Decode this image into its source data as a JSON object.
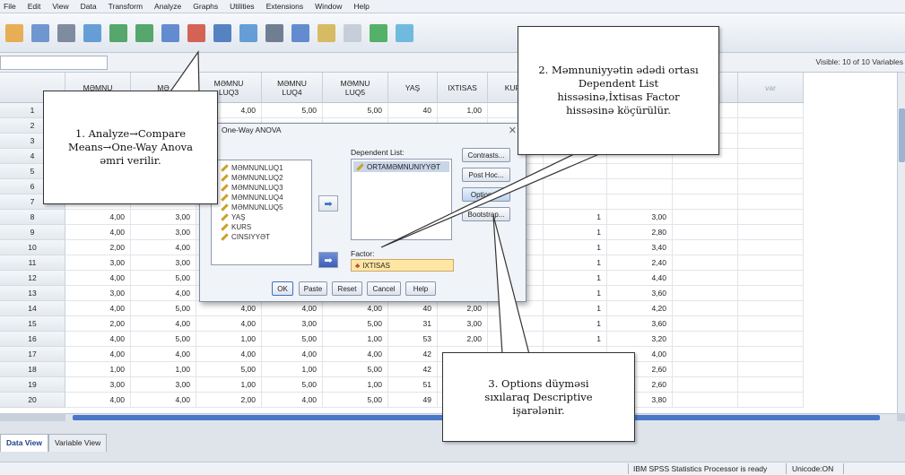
{
  "menu": [
    "File",
    "Edit",
    "View",
    "Data",
    "Transform",
    "Analyze",
    "Graphs",
    "Utilities",
    "Extensions",
    "Window",
    "Help"
  ],
  "toolbar_icons": [
    "open-icon",
    "save-icon",
    "print-icon",
    "dialog-recall-icon",
    "undo-icon",
    "redo-icon",
    "goto-case-icon",
    "goto-variable-icon",
    "variables-icon",
    "run-descriptives-icon",
    "find-icon",
    "insert-cases-icon",
    "insert-variable-icon",
    "split-file-icon",
    "weight-cases-icon",
    "select-cases-icon"
  ],
  "visible_vars": "Visible: 10 of 10 Variables",
  "columns": [
    "MƏMNU",
    "MƏ",
    "MƏMNU\nLUQ3",
    "MƏMNU\nLUQ4",
    "MƏMNU\nLUQ5",
    "YAŞ",
    "IXTISAS",
    "KURS",
    "",
    "var",
    "var",
    "var"
  ],
  "rows": [
    {
      "n": "1",
      "cells": [
        "",
        "",
        "4,00",
        "5,00",
        "5,00",
        "40",
        "1,00",
        "",
        "",
        "",
        "",
        ""
      ]
    },
    {
      "n": "2",
      "cells": [
        "",
        "",
        "",
        "",
        "",
        "",
        "",
        "",
        "",
        "",
        "",
        ""
      ]
    },
    {
      "n": "3",
      "cells": [
        "",
        "",
        "",
        "",
        "",
        "",
        "",
        "",
        "",
        "",
        "",
        ""
      ]
    },
    {
      "n": "4",
      "cells": [
        "",
        "",
        "",
        "",
        "",
        "",
        "",
        "",
        "",
        "",
        "",
        ""
      ]
    },
    {
      "n": "5",
      "cells": [
        "",
        "",
        "",
        "",
        "",
        "",
        "",
        "",
        "",
        "",
        "",
        ""
      ]
    },
    {
      "n": "6",
      "cells": [
        "",
        "",
        "",
        "",
        "",
        "",
        "",
        "",
        "",
        "",
        "",
        ""
      ]
    },
    {
      "n": "7",
      "cells": [
        "",
        "",
        "",
        "",
        "",
        "",
        "",
        "",
        "",
        "",
        "",
        ""
      ]
    },
    {
      "n": "8",
      "cells": [
        "4,00",
        "3,00",
        "",
        "",
        "",
        "",
        "",
        "",
        "1",
        "3,00",
        "",
        ""
      ]
    },
    {
      "n": "9",
      "cells": [
        "4,00",
        "3,00",
        "",
        "",
        "",
        "",
        "",
        "",
        "1",
        "2,80",
        "",
        ""
      ]
    },
    {
      "n": "10",
      "cells": [
        "2,00",
        "4,00",
        "",
        "",
        "",
        "",
        "",
        "",
        "1",
        "3,40",
        "",
        ""
      ]
    },
    {
      "n": "11",
      "cells": [
        "3,00",
        "3,00",
        "",
        "",
        "",
        "",
        "",
        "",
        "1",
        "2,40",
        "",
        ""
      ]
    },
    {
      "n": "12",
      "cells": [
        "4,00",
        "5,00",
        "",
        "",
        "",
        "",
        "",
        "",
        "1",
        "4,40",
        "",
        ""
      ]
    },
    {
      "n": "13",
      "cells": [
        "3,00",
        "4,00",
        "",
        "",
        "",
        "",
        "",
        "",
        "1",
        "3,60",
        "",
        ""
      ]
    },
    {
      "n": "14",
      "cells": [
        "4,00",
        "5,00",
        "4,00",
        "4,00",
        "4,00",
        "40",
        "2,00",
        "",
        "1",
        "4,20",
        "",
        ""
      ]
    },
    {
      "n": "15",
      "cells": [
        "2,00",
        "4,00",
        "4,00",
        "3,00",
        "5,00",
        "31",
        "3,00",
        "",
        "1",
        "3,60",
        "",
        ""
      ]
    },
    {
      "n": "16",
      "cells": [
        "4,00",
        "5,00",
        "1,00",
        "5,00",
        "1,00",
        "53",
        "2,00",
        "",
        "1",
        "3,20",
        "",
        ""
      ]
    },
    {
      "n": "17",
      "cells": [
        "4,00",
        "4,00",
        "4,00",
        "4,00",
        "4,00",
        "42",
        "",
        "",
        "",
        "4,00",
        "",
        ""
      ]
    },
    {
      "n": "18",
      "cells": [
        "1,00",
        "1,00",
        "5,00",
        "1,00",
        "5,00",
        "42",
        "",
        "",
        "",
        "2,60",
        "",
        ""
      ]
    },
    {
      "n": "19",
      "cells": [
        "3,00",
        "3,00",
        "1,00",
        "5,00",
        "1,00",
        "51",
        "",
        "",
        "",
        "2,60",
        "",
        ""
      ]
    },
    {
      "n": "20",
      "cells": [
        "4,00",
        "4,00",
        "2,00",
        "4,00",
        "5,00",
        "49",
        "",
        "",
        "",
        "3,80",
        "",
        ""
      ]
    }
  ],
  "tabs": [
    "Data View",
    "Variable View"
  ],
  "status": {
    "processor": "IBM SPSS Statistics Processor is ready",
    "unicode": "Unicode:ON"
  },
  "dialog": {
    "title": "One-Way ANOVA",
    "variables": [
      "MƏMNUNLUQ1",
      "MƏMNUNLUQ2",
      "MƏMNUNLUQ3",
      "MƏMNUNLUQ4",
      "MƏMNUNLUQ5",
      "YAŞ",
      "KURS",
      "CINSIYYƏT"
    ],
    "dependent_label": "Dependent List:",
    "dependent_items": [
      "ORTAMƏMNUNIYYƏT"
    ],
    "factor_label": "Factor:",
    "factor_value": "IXTISAS",
    "side_buttons": [
      "Contrasts...",
      "Post Hoc...",
      "Options...",
      "Bootstrap..."
    ],
    "bottom_buttons": [
      "OK",
      "Paste",
      "Reset",
      "Cancel",
      "Help"
    ]
  },
  "callouts": {
    "step1": "1. Analyze→Compare Means→One-Way Anova əmri verilir.",
    "step2": "2. Məmnuniyyətin ədədi ortası Dependent List hissəsinə,İxtisas Factor hissəsinə köçürülür.",
    "step3": "3. Options düyməsi sıxılaraq Descriptive işarələnir."
  }
}
